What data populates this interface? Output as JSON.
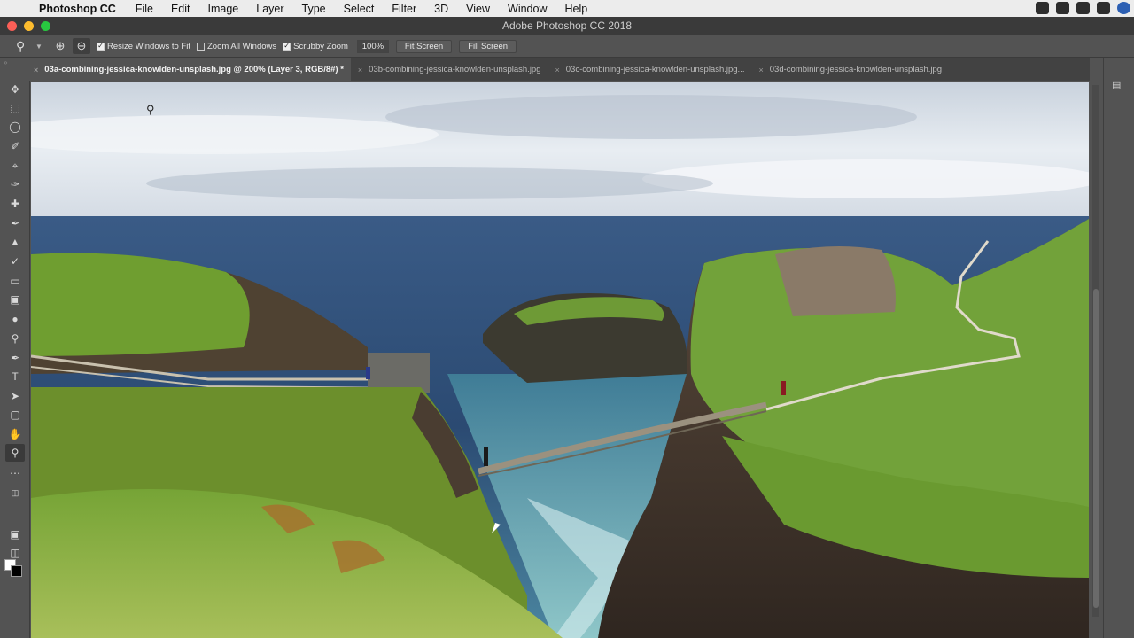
{
  "menubar": {
    "app": "Photoshop CC",
    "items": [
      "File",
      "Edit",
      "Image",
      "Layer",
      "Type",
      "Select",
      "Filter",
      "3D",
      "View",
      "Window",
      "Help"
    ]
  },
  "window": {
    "title": "Adobe Photoshop CC 2018"
  },
  "options": {
    "resize_windows": "Resize Windows to Fit",
    "zoom_all": "Zoom All Windows",
    "scrubby": "Scrubby Zoom",
    "zoom_level": "100%",
    "fit_screen": "Fit Screen",
    "fill_screen": "Fill Screen"
  },
  "tabs": [
    {
      "label": "03a-combining-jessica-knowlden-unsplash.jpg @ 200% (Layer 3, RGB/8#) *"
    },
    {
      "label": "03b-combining-jessica-knowlden-unsplash.jpg"
    },
    {
      "label": "03c-combining-jessica-knowlden-unsplash.jpg..."
    },
    {
      "label": "03d-combining-jessica-knowlden-unsplash.jpg"
    }
  ],
  "colors": {
    "sky": "#dfe5ec",
    "sea": "#2a4c75",
    "grass": "#6a9c2e",
    "rock": "#4a3a2e",
    "ui_panel": "#535353"
  }
}
